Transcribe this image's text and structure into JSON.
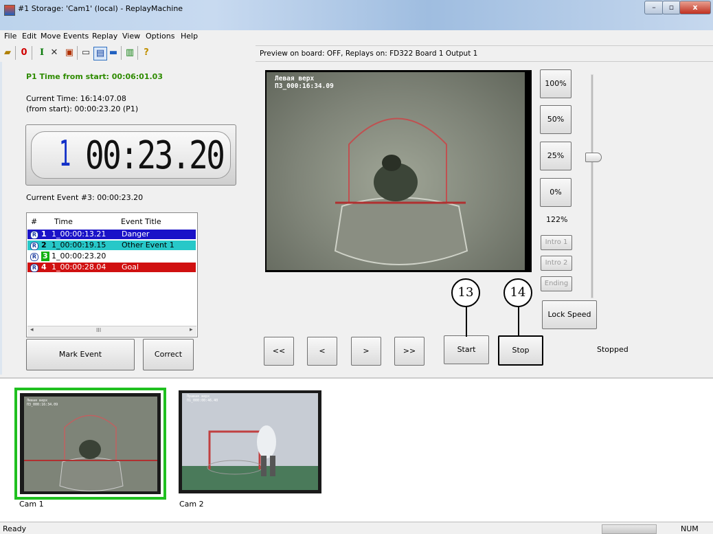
{
  "window": {
    "title": "#1 Storage: 'Cam1' (local) - ReplayMachine"
  },
  "menu": [
    "File",
    "Edit",
    "Move",
    "Events",
    "Replay",
    "View",
    "Options",
    "Help"
  ],
  "preview_status": "Preview on board: OFF, Replays on: FD322 Board 1 Output 1",
  "time_from_start": "P1 Time from start: 00:06:01.03",
  "current_time": "Current Time: 16:14:07.08",
  "from_start": "(from start): 00:00:23.20 (P1)",
  "timecode": {
    "index": "1",
    "value": "00:23.20"
  },
  "current_event": "Current Event #3: 00:00:23.20",
  "events_table": {
    "columns": [
      "#",
      "Time",
      "Event Title"
    ],
    "rows": [
      {
        "num": "1",
        "time": "1_00:00:13.21",
        "title": "Danger",
        "bg": "#1a12c8",
        "fg": "#ffffff"
      },
      {
        "num": "2",
        "time": "1_00:00:19.15",
        "title": "Other Event 1",
        "bg": "#27c8c8",
        "fg": "#000000"
      },
      {
        "num": "3",
        "time": "1_00:00:23.20",
        "title": "",
        "bg": "#ffffff",
        "fg": "#000000"
      },
      {
        "num": "4",
        "time": "1_00:00:28.04",
        "title": "Goal",
        "bg": "#d01010",
        "fg": "#ffffff"
      }
    ],
    "scroll_mark": "III"
  },
  "buttons": {
    "mark_event": "Mark Event",
    "correct": "Correct",
    "scale_100": "100%",
    "scale_50": "50%",
    "scale_25": "25%",
    "scale_0": "0%",
    "speed_value": "122%",
    "intro1": "Intro 1",
    "intro2": "Intro 2",
    "ending": "Ending",
    "lock_speed": "Lock Speed",
    "rewind_fast": "<<",
    "rewind": "<",
    "forward": ">",
    "forward_fast": ">>",
    "start": "Start",
    "stop": "Stop"
  },
  "playback_state": "Stopped",
  "callouts": {
    "start": "13",
    "stop": "14"
  },
  "video_overlay": {
    "line1": "Левая верх",
    "line2": "ПЗ_000:16:34.09"
  },
  "thumbnails": [
    {
      "label": "Cam 1",
      "ov1": "Левая верх",
      "ov2": "ПЗ_000:16:34.09",
      "selected": true
    },
    {
      "label": "Cam 2",
      "ov1": "Правая верх",
      "ov2": "П1_000:00:46.40",
      "selected": false
    }
  ],
  "statusbar": {
    "left": "Ready",
    "num": "NUM"
  },
  "colors": {
    "selection_border": "#20c020",
    "title_green": "#2e8b00",
    "timecode_index": "#1230c8"
  }
}
